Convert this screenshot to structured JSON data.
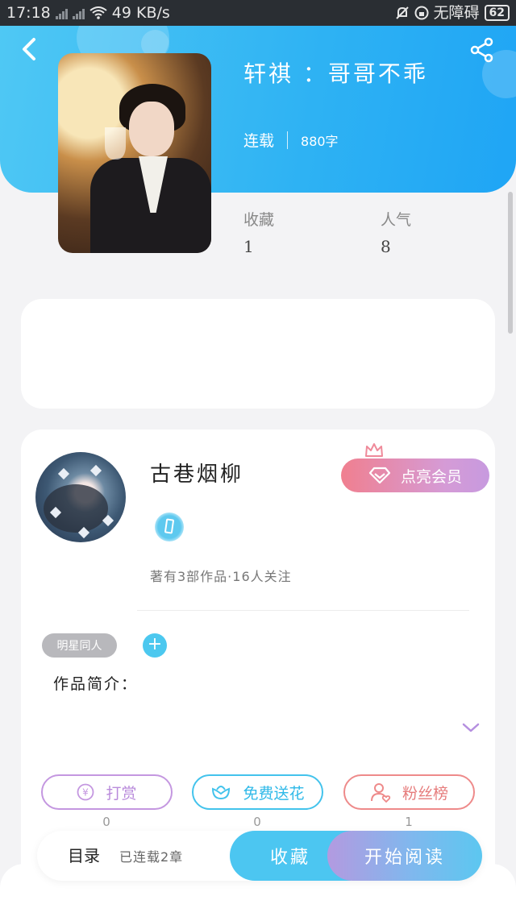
{
  "status_bar": {
    "time": "17:18",
    "speed": "49 KB/s",
    "no_barrier": "无障碍",
    "battery": "62"
  },
  "header": {
    "title": "轩祺 ：哥哥不乖",
    "status": "连载",
    "word_count": "880字"
  },
  "stats": {
    "favorites_label": "收藏",
    "favorites_value": "1",
    "popularity_label": "人气",
    "popularity_value": "8"
  },
  "author": {
    "name": "古巷烟柳",
    "summary": "著有3部作品·16人关注",
    "vip_label": "点亮会员"
  },
  "tags": {
    "chip": "明星同人",
    "add": "+"
  },
  "intro": {
    "label": "作品简介："
  },
  "actions": [
    {
      "label": "打赏",
      "count": "0",
      "color": "#c497e0",
      "icon": "yen-icon"
    },
    {
      "label": "免费送花",
      "count": "0",
      "color": "#43c3ec",
      "icon": "flower-icon"
    },
    {
      "label": "粉丝榜",
      "count": "1",
      "color": "#ee8a8a",
      "icon": "fans-icon"
    }
  ],
  "bottom_bar": {
    "toc": "目录",
    "chapters": "已连载2章",
    "favorite": "收藏",
    "start_reading": "开始阅读"
  }
}
